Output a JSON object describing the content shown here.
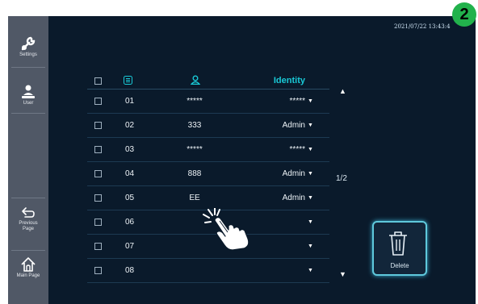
{
  "badge": "2",
  "timestamp": "2021/07/22 13:43:4",
  "sidebar": {
    "items": [
      {
        "label": "Settings",
        "icon": "settings-icon"
      },
      {
        "label": "User",
        "icon": "user-icon"
      },
      {
        "label": "Previous Page",
        "icon": "back-arrow-icon"
      },
      {
        "label": "Main Page",
        "icon": "home-icon"
      }
    ]
  },
  "table": {
    "header": {
      "identity": "Identity"
    },
    "rows": [
      {
        "num": "01",
        "user": "*****",
        "identity": "*****"
      },
      {
        "num": "02",
        "user": "333",
        "identity": "Admin"
      },
      {
        "num": "03",
        "user": "*****",
        "identity": "*****"
      },
      {
        "num": "04",
        "user": "888",
        "identity": "Admin"
      },
      {
        "num": "05",
        "user": "EE",
        "identity": "Admin"
      },
      {
        "num": "06",
        "user": "",
        "identity": ""
      },
      {
        "num": "07",
        "user": "",
        "identity": ""
      },
      {
        "num": "08",
        "user": "",
        "identity": ""
      }
    ]
  },
  "pagination": {
    "page": "1/2"
  },
  "delete_label": "Delete",
  "colors": {
    "accent": "#19c9d6",
    "background": "#0a1a2b",
    "sidebar": "#505866",
    "badge": "#22b24c"
  }
}
